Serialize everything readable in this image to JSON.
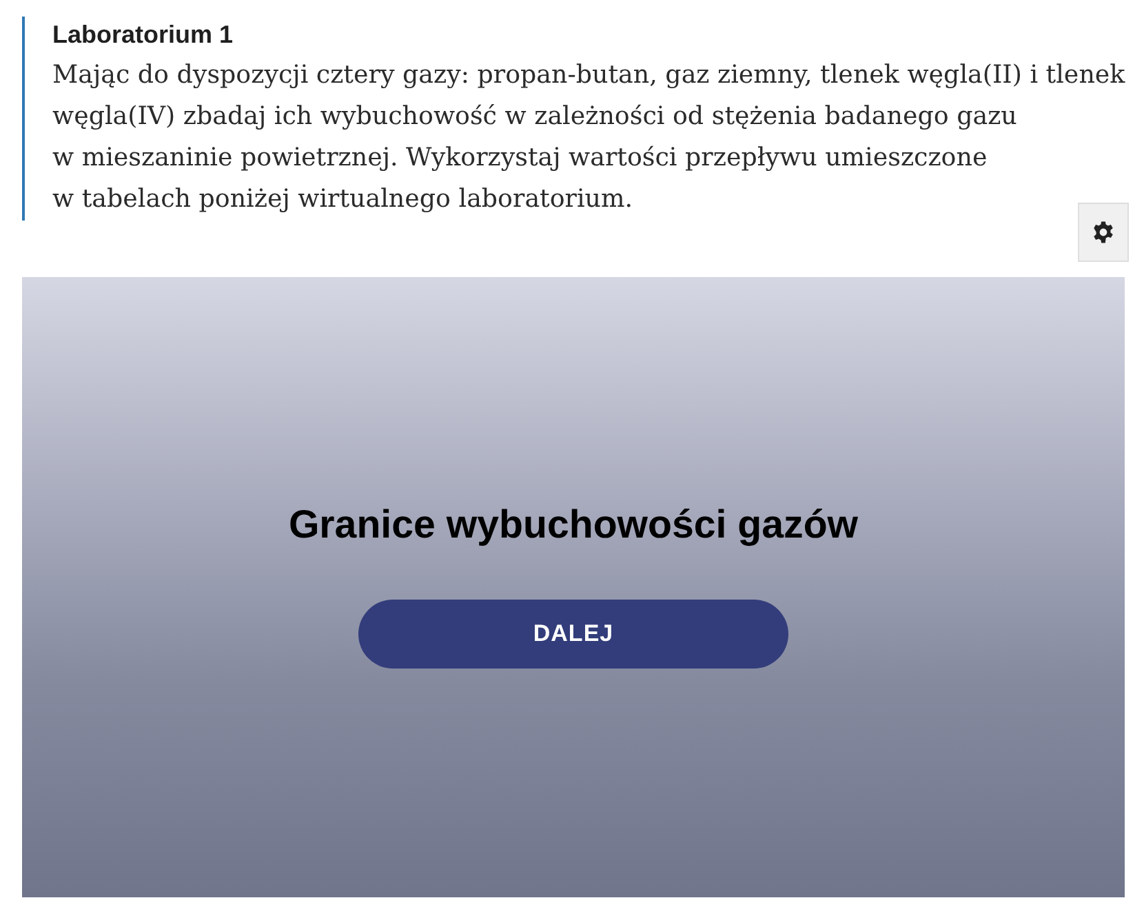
{
  "exercise": {
    "title": "Laboratorium 1",
    "text": "Mając do dyspozycji cztery gazy: propan-butan, gaz ziemny, tlenek węgla(II) i tlenek węgla(IV) zbadaj ich wybuchowość w zależności od stężenia badanego gazu w mieszaninie powietrznej. Wykorzystaj wartości przepływu umieszczone w tabelach poniżej wirtualnego laboratorium."
  },
  "lab": {
    "title": "Granice wybuchowości gazów",
    "button": "DALEJ"
  }
}
